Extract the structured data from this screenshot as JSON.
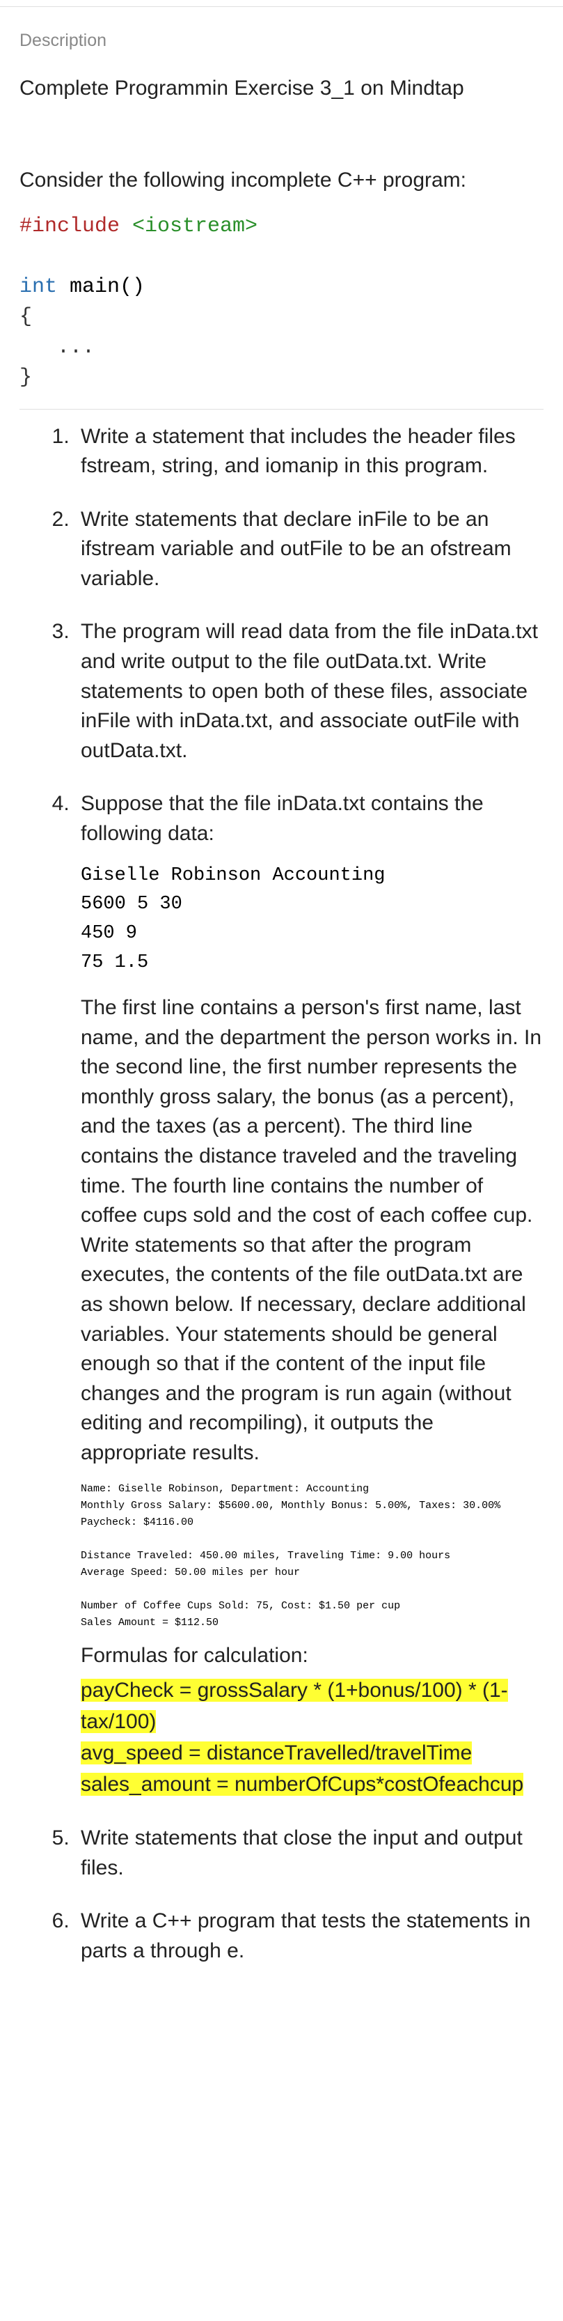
{
  "header": {
    "description_label": "Description"
  },
  "intro": "Complete Programmin Exercise 3_1 on Mindtap",
  "prompt": "Consider the following incomplete C++ program:",
  "code": {
    "line1_a": "#include",
    "line1_b": " <iostream>",
    "blank1": "",
    "line2_a": "int",
    "line2_b": " main()",
    "line3": "{",
    "line4": "   ...",
    "line5": "}"
  },
  "steps": {
    "s1": "Write a statement that includes the header files fstream, string, and iomanip in this program.",
    "s2": "Write statements that declare inFile to be an ifstream variable and outFile to be an ofstream variable.",
    "s3": "The program will read data from the file inData.txt and write output to the file outData.txt. Write statements to open both of these files, associate inFile with inData.txt, and associate outFile with outData.txt.",
    "s4_intro": "Suppose that the file inData.txt contains the following data:",
    "s4_code": "Giselle Robinson Accounting\n5600 5 30\n450 9\n75 1.5",
    "s4_body": "The first line contains a person's first name, last name, and the department the person works in. In the second line, the first number represents the monthly gross salary, the bonus (as a percent), and the taxes (as a percent). The third line contains the distance traveled and the traveling time. The fourth line contains the number of coffee cups sold and the cost of each coffee cup. Write statements so that after the program executes, the contents of the file outData.txt are as shown below. If necessary, declare additional variables. Your statements should be general enough so that if the content of the input file changes and the program is run again (without editing and recompiling), it outputs the appropriate results.",
    "s4_output": "Name: Giselle Robinson, Department: Accounting\nMonthly Gross Salary: $5600.00, Monthly Bonus: 5.00%, Taxes: 30.00%\nPaycheck: $4116.00\n\nDistance Traveled: 450.00 miles, Traveling Time: 9.00 hours\nAverage Speed: 50.00 miles per hour\n\nNumber of Coffee Cups Sold: 75, Cost: $1.50 per cup\nSales Amount = $112.50",
    "s4_formula_label": "Formulas for calculation:",
    "s4_formula1": "payCheck = grossSalary * (1+bonus/100) * (1-tax/100)",
    "s4_formula2": "avg_speed = distanceTravelled/travelTime",
    "s4_formula3": "sales_amount = numberOfCups*costOfeachcup",
    "s5": "Write statements that close the input and output files.",
    "s6": "Write a C++ program that tests the statements in parts a through e."
  }
}
